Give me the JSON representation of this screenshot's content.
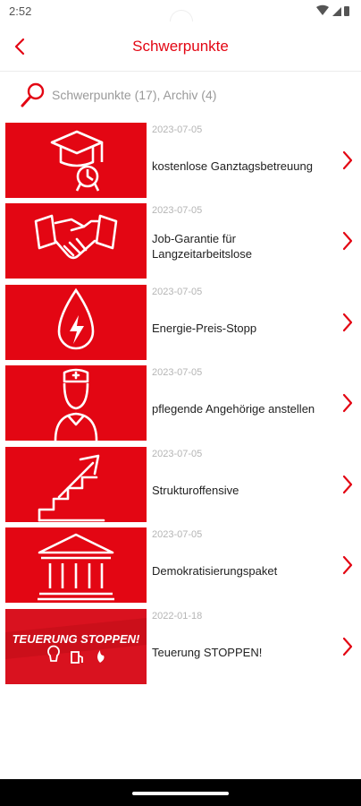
{
  "status_bar": {
    "time": "2:52"
  },
  "header": {
    "title": "Schwerpunkte"
  },
  "search": {
    "placeholder": "Schwerpunkte (17), Archiv (4)"
  },
  "colors": {
    "accent": "#e30613",
    "date": "#b5b5b5",
    "text": "#222222"
  },
  "items": [
    {
      "date": "2023-07-05",
      "title": "kostenlose Ganztagsbetreuung",
      "icon": "graduation-cap-icon"
    },
    {
      "date": "2023-07-05",
      "title": "Job-Garantie für Langzeitarbeitslose",
      "icon": "handshake-icon"
    },
    {
      "date": "2023-07-05",
      "title": "Energie-Preis-Stopp",
      "icon": "energy-drop-icon"
    },
    {
      "date": "2023-07-05",
      "title": "pflegende Angehörige anstellen",
      "icon": "nurse-icon"
    },
    {
      "date": "2023-07-05",
      "title": "Strukturoffensive",
      "icon": "stairs-arrow-icon"
    },
    {
      "date": "2023-07-05",
      "title": "Demokratisierungspaket",
      "icon": "parliament-icon"
    },
    {
      "date": "2022-01-18",
      "title": "Teuerung STOPPEN!",
      "icon": "teuerung-banner-icon",
      "banner_text": "TEUERUNG STOPPEN!"
    }
  ]
}
